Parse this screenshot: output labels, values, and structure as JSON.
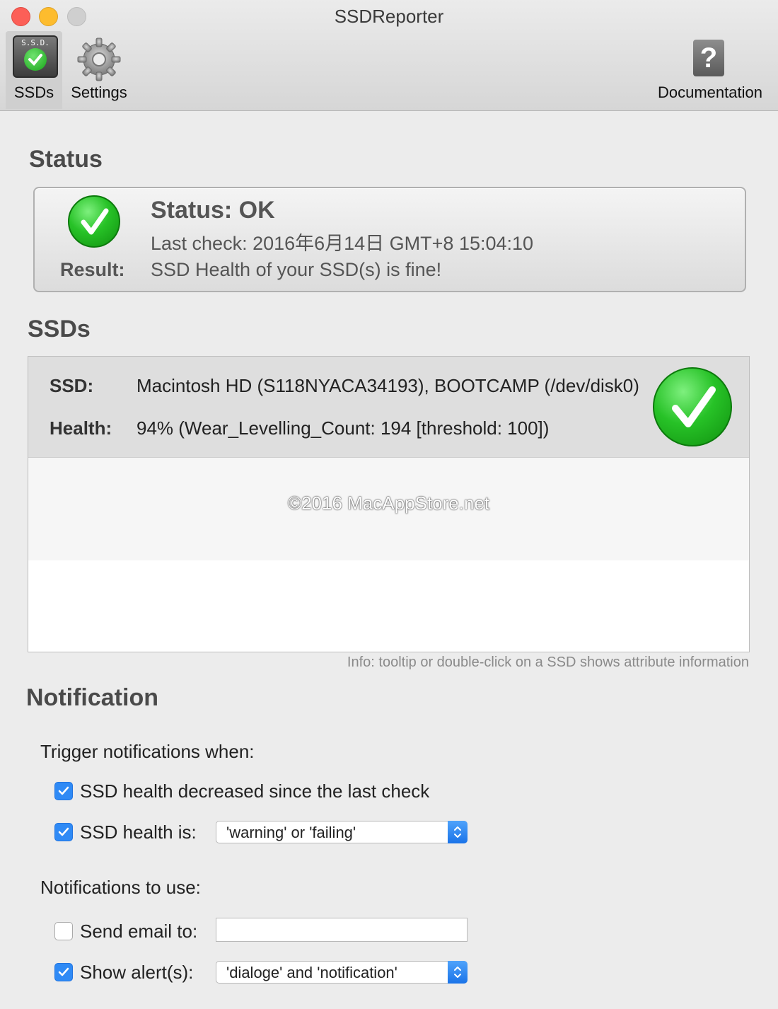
{
  "window": {
    "title": "SSDReporter"
  },
  "toolbar": {
    "ssds_label": "SSDs",
    "ssds_icon_text": "S.S.D.",
    "settings_label": "Settings",
    "documentation_label": "Documentation",
    "documentation_icon_glyph": "?"
  },
  "status": {
    "heading": "Status",
    "title": "Status: OK",
    "last_check": "Last check: 2016年6月14日 GMT+8 15:04:10",
    "result_label": "Result:",
    "result_text": "SSD Health of your SSD(s) is fine!"
  },
  "ssds": {
    "heading": "SSDs",
    "rows": [
      {
        "ssd_label": "SSD:",
        "ssd_value": "Macintosh HD (S118NYACA34193), BOOTCAMP  (/dev/disk0)",
        "health_label": "Health:",
        "health_value": "94% (Wear_Levelling_Count: 194 [threshold: 100])"
      }
    ],
    "watermark": "©2016 MacAppStore.net",
    "info": "Info: tooltip or double-click on a SSD shows attribute information"
  },
  "notification": {
    "heading": "Notification",
    "trigger_heading": "Trigger notifications when:",
    "health_decreased_label": "SSD health decreased since the last check",
    "health_decreased_checked": true,
    "health_is_label": "SSD health is:",
    "health_is_checked": true,
    "health_is_value": "'warning' or 'failing'",
    "use_heading": "Notifications to use:",
    "email_label": "Send email to:",
    "email_checked": false,
    "email_value": "",
    "alerts_label": "Show alert(s):",
    "alerts_checked": true,
    "alerts_value": "'dialoge' and 'notification'"
  },
  "colors": {
    "accent": "#2f8af5",
    "ok_green": "#27c227"
  }
}
